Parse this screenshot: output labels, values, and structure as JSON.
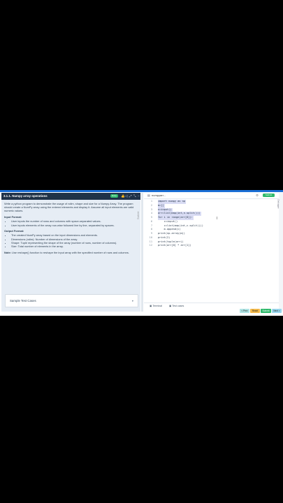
{
  "problem": {
    "title": "3.1.1. Numpy array operations",
    "badge": "Easy",
    "intro": "Write a python program to demonstrate the usage of ndim, shape and size for a Numpy Array. The program should create a NumPy array using the entered elements and display it. Assume all input elements are valid numeric values.",
    "input_heading": "Input Format:",
    "input_items": [
      "User inputs the number of rows and columns with space-separated values.",
      "User inputs elements of the array row-wise followed line by line, separated by spaces."
    ],
    "output_heading": "Output Format:",
    "output_items": [
      "The created NumPy array based on the input dimensions and elements.",
      "Dimensions (ndim): Number of dimensions of the array.",
      "Shape: Tuple representing the shape of the array (number of rows, number of columns).",
      "Size: Total number of elements in the array."
    ],
    "note_label": "Note:",
    "note_text": " Use reshape() function to reshape the input array with the specified number of rows and columns.",
    "sample_label": "Sample Test Cases"
  },
  "editor": {
    "filename": "numpyarr...",
    "submit_label": "Submit",
    "side_label": "Explorer",
    "right_label": "Debugger",
    "lines": [
      {
        "n": "1",
        "code": "import numpy as np",
        "hl": 1
      },
      {
        "n": "2",
        "code": "m=[]",
        "hl": 1
      },
      {
        "n": "3",
        "code": "n=input()",
        "hl": 1
      },
      {
        "n": "4",
        "code": "arr=list(map(int,n.split()))",
        "hl": 1
      },
      {
        "n": "5",
        "code": "for i in range(arr[0]):",
        "hl": 1
      },
      {
        "n": "6",
        "code": "    c=input()",
        "hl": 0
      },
      {
        "n": "7",
        "code": "    c=list(map(int,c.split()))",
        "hl": 0
      },
      {
        "n": "8",
        "code": "    m.append(c)",
        "hl": 0
      },
      {
        "n": "9",
        "code": "print(np.array(m))",
        "hl": 0
      },
      {
        "n": "10",
        "code": "print(2)",
        "hl": 0
      },
      {
        "n": "11",
        "code": "print(tuple(arr))",
        "hl": 0
      },
      {
        "n": "12",
        "code": "print(arr[0] * arr[1])",
        "hl": 0
      }
    ],
    "terminal_label": "Terminal",
    "testcases_label": "Test cases"
  },
  "footer": {
    "prev_label": "< Prev",
    "reset_label": "Reset",
    "submit_label": "Submit",
    "next_label": "Next >"
  },
  "colors": {
    "accent": "#1b6fd6",
    "header_dark": "#1f3248",
    "easy_green": "#2fb96c",
    "selection": "#d9dcf4",
    "panel_bg": "#e6edf5"
  }
}
